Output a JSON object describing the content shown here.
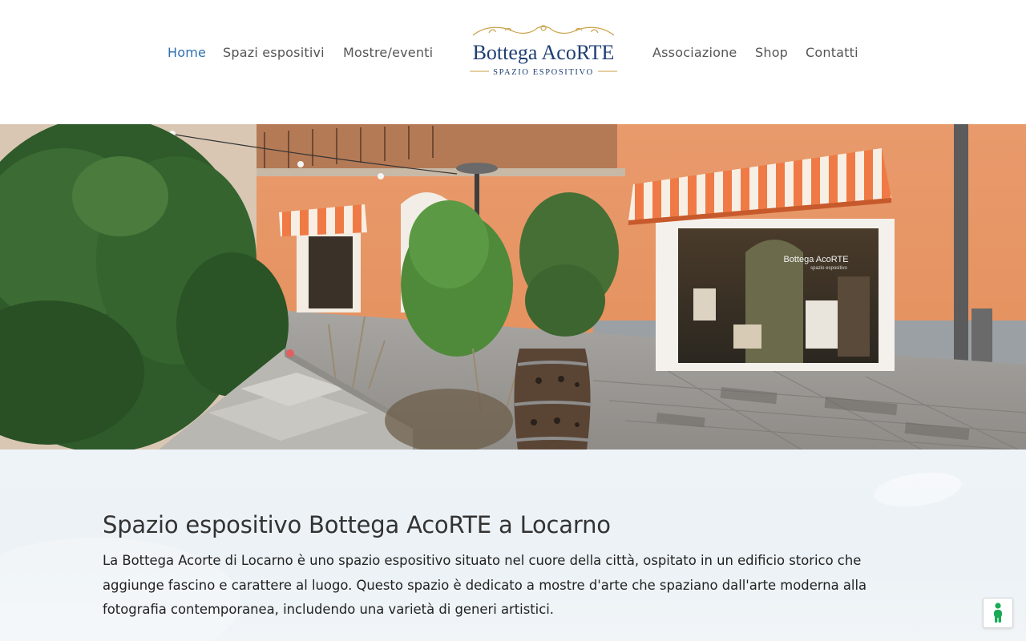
{
  "nav": {
    "left": [
      {
        "label": "Home",
        "active": true
      },
      {
        "label": "Spazi espositivi",
        "active": false
      },
      {
        "label": "Mostre/eventi",
        "active": false
      }
    ],
    "right": [
      {
        "label": "Associazione",
        "active": false
      },
      {
        "label": "Shop",
        "active": false
      },
      {
        "label": "Contatti",
        "active": false
      }
    ]
  },
  "logo": {
    "title": "Bottega AcoRTE",
    "subtitle": "SPAZIO ESPOSITIVO"
  },
  "hero": {
    "shop_sign": "Bottega AcoRTE",
    "shop_sign_sub": "spazio espositivo"
  },
  "section": {
    "title": "Spazio espositivo Bottega AcoRTE a Locarno",
    "text": "La Bottega Acorte di Locarno è uno spazio espositivo situato nel cuore della città, ospitato in un edificio storico che aggiunge fascino e carattere al luogo. Questo spazio è dedicato a mostre d'arte che spaziano dall'arte moderna alla fotografia contemporanea, includendo una varietà di generi artistici."
  },
  "colors": {
    "nav_active": "#2e6fb0",
    "nav_default": "#555555",
    "logo_text": "#1f3f73",
    "logo_gold": "#c9a24a",
    "content_bg": "#eef3f8",
    "accessibility_icon": "#1aaa55"
  },
  "icons": {
    "accessibility": "accessibility-icon"
  }
}
